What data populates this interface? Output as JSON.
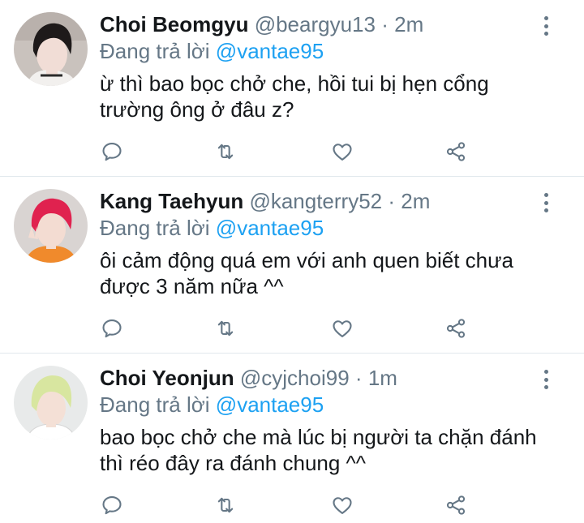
{
  "tweets": [
    {
      "name": "Choi Beomgyu",
      "handle": "@beargyu13",
      "separator": "·",
      "time": "2m",
      "reply_prefix": "Đang trả lời",
      "reply_to": "@vantae95",
      "text": "ừ thì bao bọc chở che, hồi tui bị hẹn cổng trường ông ở đâu z?",
      "avatar_icon": "profile-photo",
      "avatar_colors": {
        "bg": "#c9c2bd",
        "hair": "#1e1a1a",
        "skin": "#f1ddd6",
        "shirt": "#f2f0ee"
      }
    },
    {
      "name": "Kang Taehyun",
      "handle": "@kangterry52",
      "separator": "·",
      "time": "2m",
      "reply_prefix": "Đang trả lời",
      "reply_to": "@vantae95",
      "text": "ôi cảm động quá em với anh quen biết chưa được 3 năm nữa ^^",
      "avatar_icon": "profile-photo",
      "avatar_colors": {
        "bg": "#d9d4d2",
        "hair": "#e0224f",
        "skin": "#f3dcd2",
        "shirt": "#f08a2c"
      }
    },
    {
      "name": "Choi Yeonjun",
      "handle": "@cyjchoi99",
      "separator": "·",
      "time": "1m",
      "reply_prefix": "Đang trả lời",
      "reply_to": "@vantae95",
      "text": "bao bọc chở che mà lúc bị người ta chặn đánh thì réo đây ra đánh chung ^^",
      "avatar_icon": "profile-photo",
      "avatar_colors": {
        "bg": "#e8eaea",
        "hair": "#d8e6a0",
        "skin": "#f4e0d6",
        "shirt": "#ffffff"
      }
    }
  ],
  "icons": {
    "reply": "reply-icon",
    "retweet": "retweet-icon",
    "like": "like-icon",
    "share": "share-icon",
    "more": "more-options-icon"
  },
  "colors": {
    "text": "#14171a",
    "muted": "#657786",
    "accent": "#1da1f2",
    "divider": "#e1e8ed"
  }
}
